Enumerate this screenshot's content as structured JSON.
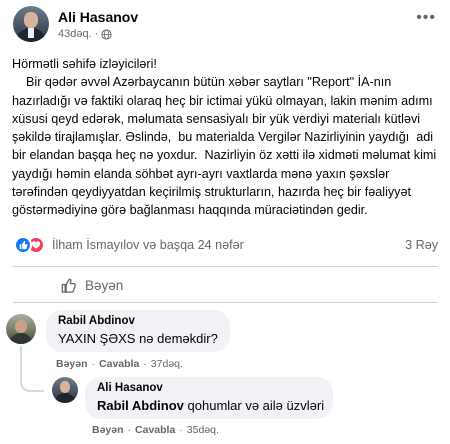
{
  "post": {
    "author": "Ali Hasanov",
    "time": "43dəq.",
    "paragraphs": [
      "Hörmətli səhifə izləyiciləri!",
      "    Bir qədər əvvəl Azərbaycanın bütün xəbər saytları \"Report\" İA-nın hazırladığı və faktiki olaraq heç bir ictimai yükü olmayan, lakin mənim adımı xüsusi qeyd edərək, məlumata sensasiyalı bir yük verdiyi materialı kütləvi şəkildə tirajlamışlar. Əslində,  bu materialda Vergilər Nazirliyinin yaydığı  adi bir elandan başqa heç nə yoxdur.  Nazirliyin öz xətti ilə xidməti məlumat kimi yaydığı həmin elanda söhbət ayrı-ayrı vaxtlarda mənə yaxın şəxslər tərəfindən qeydiyyatdan keçirilmiş strukturların, hazırda heç bir fəaliyyət göstərmədiyinə görə bağlanması haqqında müraciətindən gedir."
    ]
  },
  "reactions": {
    "text": "İlham İsmayılov və başqa 24 nəfər",
    "comments_count": "3 Rəy"
  },
  "actions": {
    "like_label": "Bəyən"
  },
  "comments": [
    {
      "author": "Rabil Abdinov",
      "text": "YAXIN ŞƏXS nə deməkdir?",
      "like": "Bəyən",
      "reply": "Cavabla",
      "time": "37dəq."
    },
    {
      "author": "Ali Hasanov",
      "mention": "Rabil Abdinov",
      "text": " qohumlar və ailə üzvləri",
      "like": "Bəyən",
      "reply": "Cavabla",
      "time": "35dəq."
    }
  ],
  "colors": {
    "like_blue": "#1877f2",
    "love_red": "#f33e58",
    "secondary_text": "#65676b",
    "bubble_bg": "#f0f2f5"
  },
  "icons": [
    "globe-icon",
    "more-icon",
    "like-reaction-icon",
    "love-reaction-icon",
    "like-thumb-icon"
  ]
}
